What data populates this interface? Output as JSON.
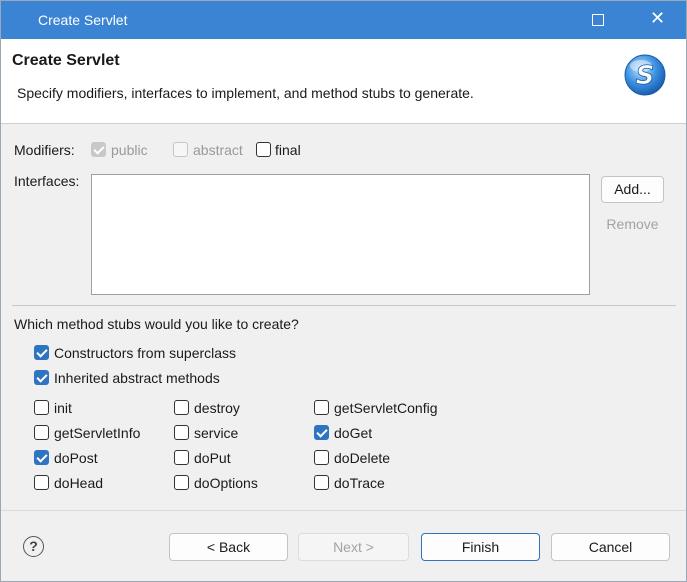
{
  "window": {
    "title": "Create Servlet"
  },
  "banner": {
    "heading": "Create Servlet",
    "description": "Specify modifiers, interfaces to implement, and method stubs to generate.",
    "logo_letter": "S"
  },
  "modifiers": {
    "label": "Modifiers:",
    "public": {
      "label": "public",
      "checked": true,
      "enabled": false
    },
    "abstract": {
      "label": "abstract",
      "checked": false,
      "enabled": false
    },
    "final": {
      "label": "final",
      "checked": false,
      "enabled": true
    }
  },
  "interfaces": {
    "label": "Interfaces:",
    "items": [],
    "add_label": "Add...",
    "remove_label": "Remove"
  },
  "stubs": {
    "question": "Which method stubs would you like to create?",
    "constructors": {
      "label": "Constructors from superclass",
      "checked": true
    },
    "inherited": {
      "label": "Inherited abstract methods",
      "checked": true
    },
    "methods": [
      {
        "label": "init",
        "checked": false
      },
      {
        "label": "destroy",
        "checked": false
      },
      {
        "label": "getServletConfig",
        "checked": false
      },
      {
        "label": "getServletInfo",
        "checked": false
      },
      {
        "label": "service",
        "checked": false
      },
      {
        "label": "doGet",
        "checked": true
      },
      {
        "label": "doPost",
        "checked": true
      },
      {
        "label": "doPut",
        "checked": false
      },
      {
        "label": "doDelete",
        "checked": false
      },
      {
        "label": "doHead",
        "checked": false
      },
      {
        "label": "doOptions",
        "checked": false
      },
      {
        "label": "doTrace",
        "checked": false
      }
    ]
  },
  "footer": {
    "help_icon": "question-icon",
    "help_glyph": "?",
    "back_label": "< Back",
    "next_label": "Next >",
    "finish_label": "Finish",
    "cancel_label": "Cancel"
  },
  "colors": {
    "titlebar": "#3b84d4",
    "checkbox_accent": "#2f74c0"
  }
}
